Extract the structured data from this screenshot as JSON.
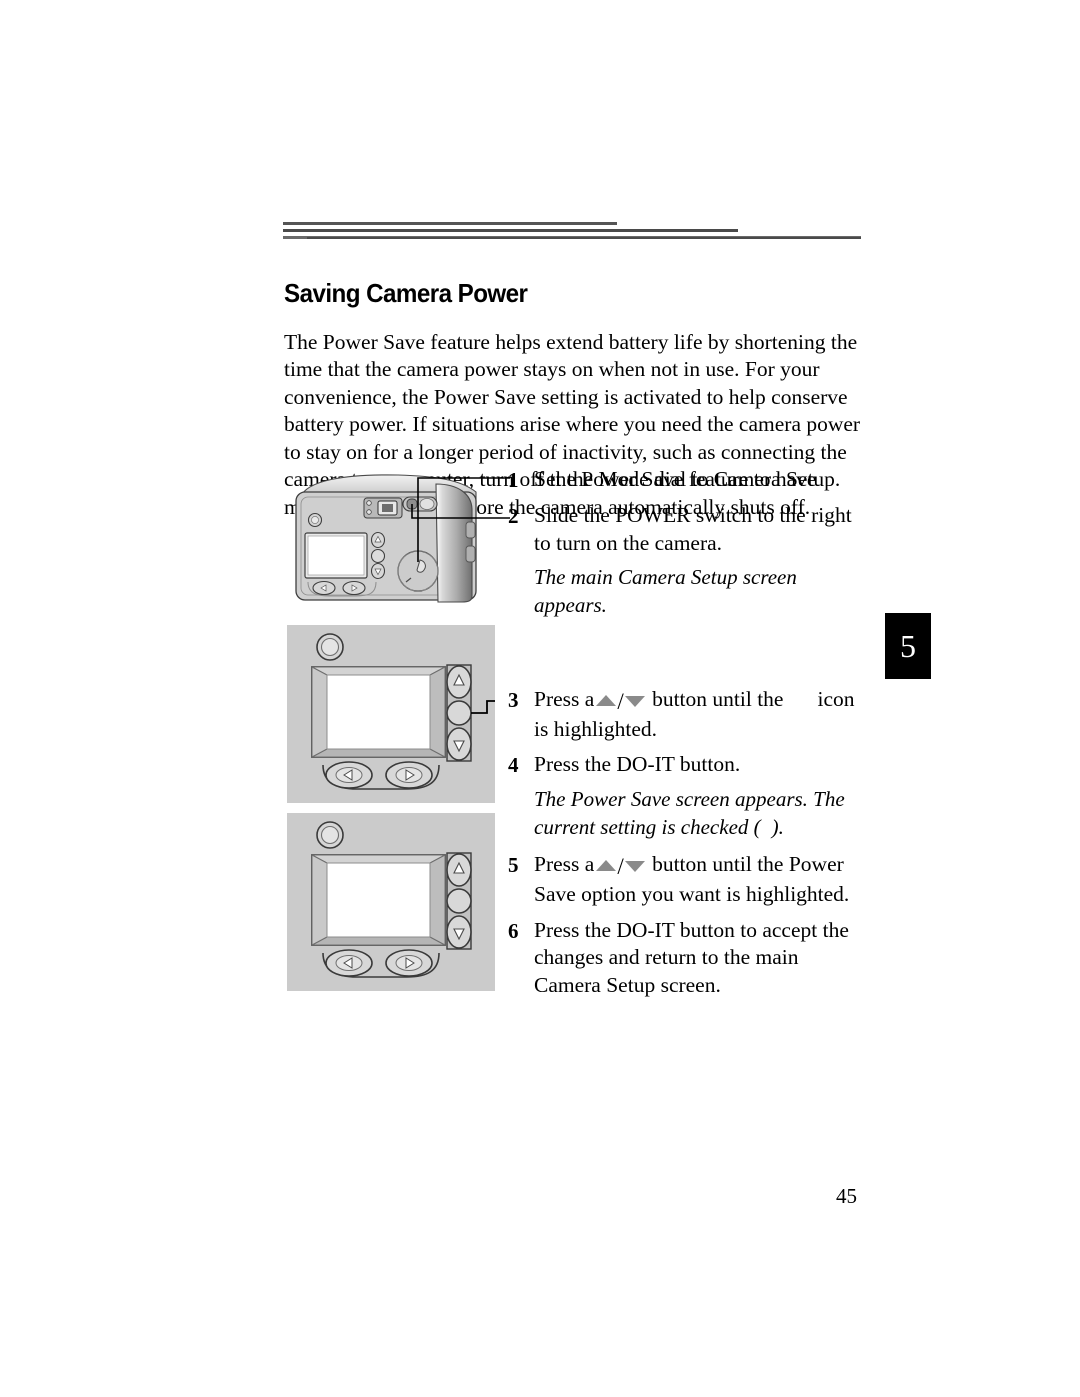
{
  "document": {
    "heading": "Saving Camera Power",
    "intro": "The Power Save feature helps extend battery life by shortening the time that the camera power stays on when not in use. For your convenience, the Power Save setting is activated to help conserve battery power. If situations arise where you need the camera power to stay on for a longer period of inactivity, such as connecting the camera to a computer, turn off the Power Save feature to have more time to work before the camera automatically shuts off.",
    "chapter_tab": "5",
    "page_number": "45"
  },
  "steps": {
    "s1": {
      "num": "1",
      "text": "Set the Mode dial to Camera Setup."
    },
    "s2": {
      "num": "2",
      "text": "Slide the POWER switch to the right to turn on the camera."
    },
    "note1": "The main Camera Setup screen appears.",
    "s3": {
      "num": "3",
      "text_before": "Press a",
      "text_middle": "button until the",
      "text_after": "icon is highlighted."
    },
    "s4": {
      "num": "4",
      "text": "Press the DO-IT button."
    },
    "note2_before": "The Power Save screen appears. The current setting is checked (",
    "note2_after": ").",
    "s5": {
      "num": "5",
      "text_before": "Press a",
      "text_after": "button until the Power Save option you want is highlighted."
    },
    "s6": {
      "num": "6",
      "text": "Press the DO-IT button to accept the changes and return to the main Camera Setup screen."
    }
  },
  "illustrations": {
    "camera": {
      "name": "camera-back-view",
      "callout_1_label": "1",
      "callout_2_label": "2",
      "parts": [
        "viewfinder",
        "lcd-screen",
        "up-button",
        "do-it-button",
        "down-button",
        "left-button",
        "right-button",
        "mode-dial",
        "power-switch"
      ]
    },
    "lcd_panel_1": {
      "name": "camera-lcd-panel-camera-setup",
      "parts": [
        "viewfinder-window",
        "lcd-screen",
        "up-button",
        "do-it-button",
        "down-button",
        "left-button",
        "right-button"
      ],
      "callout": "do-it-button"
    },
    "lcd_panel_2": {
      "name": "camera-lcd-panel-power-save",
      "parts": [
        "viewfinder-window",
        "lcd-screen",
        "up-button",
        "do-it-button",
        "down-button",
        "left-button",
        "right-button"
      ]
    }
  },
  "colors": {
    "rule": "#4d4d4d",
    "body_gray": "#c8c8c8",
    "arrow_gray": "#8a8a8a",
    "tab_bg": "#000000",
    "tab_fg": "#ffffff"
  }
}
